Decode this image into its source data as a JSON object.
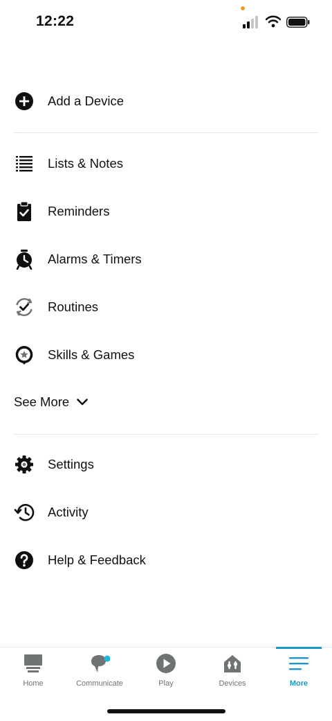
{
  "status": {
    "time": "12:22"
  },
  "menu": {
    "add_device": "Add a Device",
    "lists_notes": "Lists & Notes",
    "reminders": "Reminders",
    "alarms_timers": "Alarms & Timers",
    "routines": "Routines",
    "skills_games": "Skills & Games",
    "see_more": "See More",
    "settings": "Settings",
    "activity": "Activity",
    "help_feedback": "Help & Feedback"
  },
  "nav": {
    "home": "Home",
    "communicate": "Communicate",
    "play": "Play",
    "devices": "Devices",
    "more": "More"
  },
  "colors": {
    "accent": "#1a98c8",
    "text": "#0f1111",
    "nav_inactive": "#6f7373",
    "notification_dot": "#1ab6e8"
  }
}
